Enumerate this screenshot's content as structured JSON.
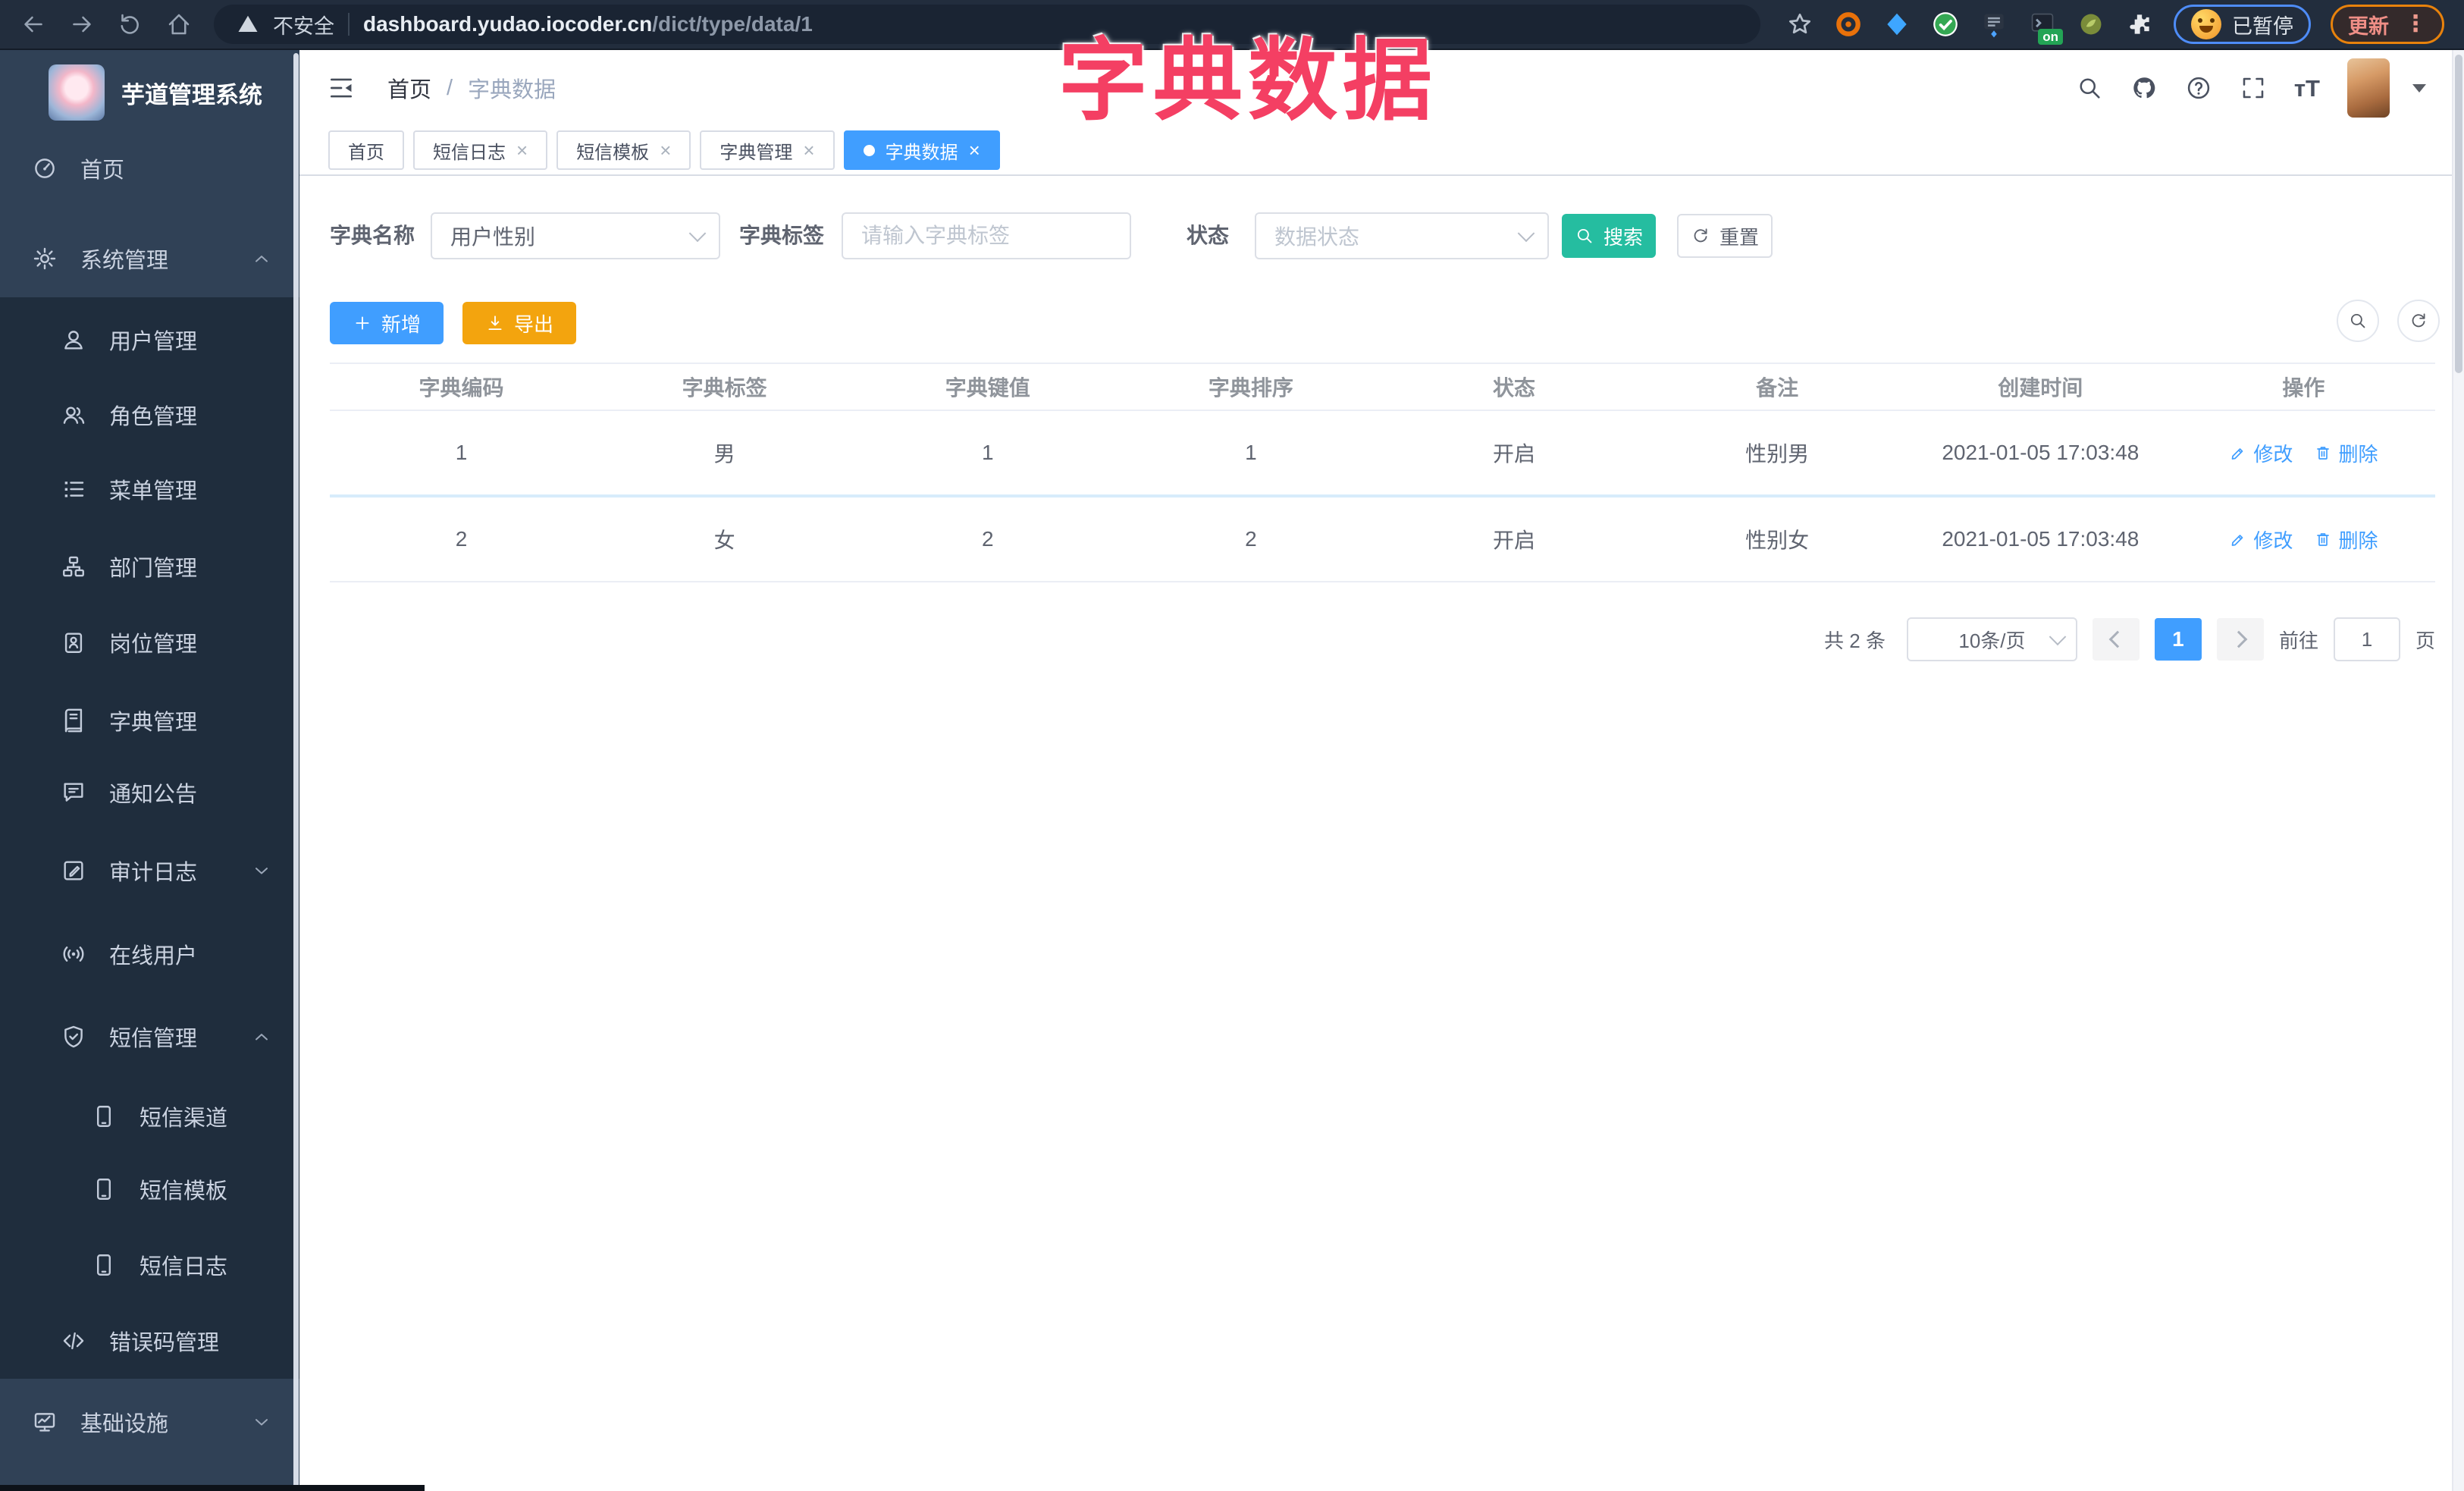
{
  "browser": {
    "security_label": "不安全",
    "url_host": "dashboard.yudao.iocoder.cn",
    "url_path": "/dict/type/data/1",
    "on_badge": "on",
    "paused_label": "已暂停",
    "update_label": "更新"
  },
  "overlay_title": "字典数据",
  "sidebar": {
    "logo_title": "芋道管理系统",
    "items": [
      {
        "label": "首页",
        "icon": "dashboard-icon"
      },
      {
        "label": "系统管理",
        "icon": "gear-icon",
        "chevron": "up"
      },
      {
        "label": "用户管理",
        "icon": "user-icon"
      },
      {
        "label": "角色管理",
        "icon": "users-icon"
      },
      {
        "label": "菜单管理",
        "icon": "menu-list-icon"
      },
      {
        "label": "部门管理",
        "icon": "org-tree-icon"
      },
      {
        "label": "岗位管理",
        "icon": "badge-icon"
      },
      {
        "label": "字典管理",
        "icon": "book-icon"
      },
      {
        "label": "通知公告",
        "icon": "chat-bubble-icon"
      },
      {
        "label": "审计日志",
        "icon": "log-icon",
        "chevron": "down"
      },
      {
        "label": "在线用户",
        "icon": "online-icon"
      },
      {
        "label": "短信管理",
        "icon": "shield-check-icon",
        "chevron": "up"
      },
      {
        "label": "短信渠道",
        "icon": "phone-icon"
      },
      {
        "label": "短信模板",
        "icon": "phone-icon"
      },
      {
        "label": "短信日志",
        "icon": "phone-icon"
      },
      {
        "label": "错误码管理",
        "icon": "code-icon"
      },
      {
        "label": "基础设施",
        "icon": "monitor-icon",
        "chevron": "down"
      }
    ]
  },
  "navbar": {
    "breadcrumb_home": "首页",
    "breadcrumb_sep": "/",
    "breadcrumb_current": "字典数据"
  },
  "tabs": [
    {
      "label": "首页"
    },
    {
      "label": "短信日志"
    },
    {
      "label": "短信模板"
    },
    {
      "label": "字典管理"
    },
    {
      "label": "字典数据"
    }
  ],
  "filters": {
    "dict_name_label": "字典名称",
    "dict_name_value": "用户性别",
    "dict_label_label": "字典标签",
    "dict_label_placeholder": "请输入字典标签",
    "status_label": "状态",
    "status_placeholder": "数据状态",
    "search_label": "搜索",
    "reset_label": "重置"
  },
  "toolbar": {
    "add_label": "新增",
    "export_label": "导出"
  },
  "table": {
    "columns": [
      "字典编码",
      "字典标签",
      "字典键值",
      "字典排序",
      "状态",
      "备注",
      "创建时间",
      "操作"
    ],
    "rows": [
      {
        "code": "1",
        "label": "男",
        "value": "1",
        "sort": "1",
        "status": "开启",
        "remark": "性别男",
        "created_at": "2021-01-05 17:03:48",
        "edit_label": "修改",
        "delete_label": "删除"
      },
      {
        "code": "2",
        "label": "女",
        "value": "2",
        "sort": "2",
        "status": "开启",
        "remark": "性别女",
        "created_at": "2021-01-05 17:03:48",
        "edit_label": "修改",
        "delete_label": "删除"
      }
    ]
  },
  "pagination": {
    "total_label": "共 2 条",
    "size_label": "10条/页",
    "current_page": "1",
    "goto_label": "前往",
    "goto_value": "1",
    "unit_label": "页"
  },
  "colors": {
    "accent": "#409eff",
    "search_teal": "#25bda0",
    "export_orange": "#f3a40e",
    "overlay_pink": "#f43f63",
    "sidebar_bg": "#304156",
    "submenu_bg": "#1f2d3d"
  }
}
